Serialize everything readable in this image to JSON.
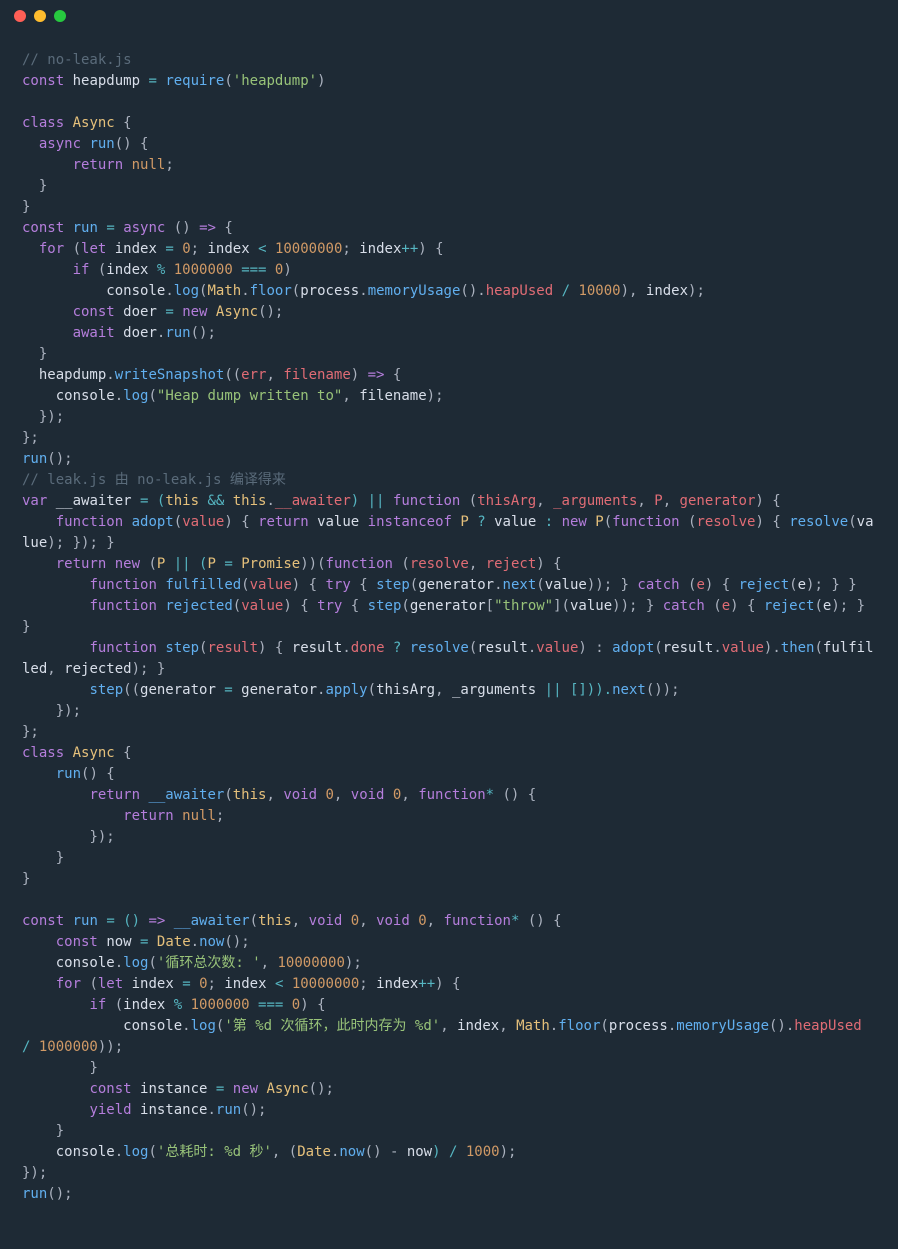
{
  "titlebar": {
    "buttons": [
      "close",
      "minimize",
      "zoom"
    ]
  },
  "code": {
    "comment1": "// no-leak.js",
    "l2_const": "const",
    "l2_var": "heapdump",
    "l2_eq": " = ",
    "l2_req": "require",
    "l2_paren_o": "(",
    "l2_str": "'heapdump'",
    "l2_paren_c": ")",
    "l4_class": "class",
    "l4_name": "Async",
    "l4_brace": " {",
    "l5_async": "  async",
    "l5_run": "run",
    "l5_rest": "() {",
    "l6_ret": "      return",
    "l6_null": "null",
    "l6_semi": ";",
    "l7": "  }",
    "l8": "}",
    "l9_const": "const",
    "l9_run": "run",
    "l9_eq": " = ",
    "l9_async": "async",
    "l9_arrow": " () ",
    "l9_fat": "=>",
    "l9_brace": " {",
    "l10_for": "  for",
    "l10_paren": " (",
    "l10_let": "let",
    "l10_idx": "index",
    "l10_eq": " = ",
    "l10_zero": "0",
    "l10_semi1": "; ",
    "l10_idx2": "index",
    "l10_lt": " < ",
    "l10_max": "10000000",
    "l10_semi2": "; ",
    "l10_idx3": "index",
    "l10_inc": "++",
    "l10_end": ") {",
    "l11_if": "      if",
    "l11_paren": " (",
    "l11_idx": "index",
    "l11_mod": " % ",
    "l11_mil": "1000000",
    "l11_eq3": " === ",
    "l11_zero": "0",
    "l11_close": ")",
    "l12_cons": "          console",
    "l12_dot": ".",
    "l12_log": "log",
    "l12_po": "(",
    "l12_math": "Math",
    "l12_d2": ".",
    "l12_floor": "floor",
    "l12_po2": "(",
    "l12_proc": "process",
    "l12_d3": ".",
    "l12_mu": "memoryUsage",
    "l12_call": "().",
    "l12_hu": "heapUsed",
    "l12_div": " / ",
    "l12_ten": "10000",
    "l12_pc": "), ",
    "l12_idx": "index",
    "l12_end": ");",
    "l13_const": "      const",
    "l13_doer": "doer",
    "l13_eq": " = ",
    "l13_new": "new",
    "l13_async": "Async",
    "l13_end": "();",
    "l14_await": "      await",
    "l14_doer": "doer",
    "l14_d": ".",
    "l14_run": "run",
    "l14_end": "();",
    "l15": "  }",
    "l16_hd": "  heapdump",
    "l16_d": ".",
    "l16_ws": "writeSnapshot",
    "l16_po": "((",
    "l16_err": "err",
    "l16_c": ", ",
    "l16_fn": "filename",
    "l16_pc": ") ",
    "l16_fat": "=>",
    "l16_br": " {",
    "l17_cons": "    console",
    "l17_d": ".",
    "l17_log": "log",
    "l17_po": "(",
    "l17_str": "\"Heap dump written to\"",
    "l17_c": ", ",
    "l17_fn": "filename",
    "l17_end": ");",
    "l18": "  });",
    "l19": "};",
    "l20_run": "run",
    "l20_end": "();",
    "comment2": "// leak.js 由 no-leak.js 编译得来",
    "l22_var": "var",
    "l22_aw": "__awaiter",
    "l22_eq": " = (",
    "l22_this": "this",
    "l22_and": " && ",
    "l22_this2": "this",
    "l22_d": ".",
    "l22_aw2": "__awaiter",
    "l22_or": ") || ",
    "l22_fn": "function",
    "l22_args": " (",
    "l22_ta": "thisArg",
    "l22_c1": ", ",
    "l22_ua": "_arguments",
    "l22_c2": ", ",
    "l22_p": "P",
    "l22_c3": ", ",
    "l22_gen": "generator",
    "l22_end": ") {",
    "l23_fn": "    function",
    "l23_adopt": "adopt",
    "l23_po": "(",
    "l23_val": "value",
    "l23_pc": ") { ",
    "l23_ret": "return",
    "l23_val2": " value ",
    "l23_inst": "instanceof",
    "l23_p": " P ",
    "l23_q": "? ",
    "l23_val3": "value",
    "l23_col": " : ",
    "l23_new": "new",
    "l23_p2": " P",
    "l23_po2": "(",
    "l23_fn2": "function",
    "l23_po3": " (",
    "l23_res": "resolve",
    "l23_pc3": ") { ",
    "l23_res2": "resolve",
    "l23_po4": "(",
    "l23_val4": "value",
    "l23_end": "); }); }",
    "l24_ret": "    return",
    "l24_new": "new",
    "l24_po": " (",
    "l24_p": "P",
    "l24_or": " || (",
    "l24_p2": "P",
    "l24_eq": " = ",
    "l24_prom": "Promise",
    "l24_pc": "))(",
    "l24_fn": "function",
    "l24_po2": " (",
    "l24_res": "resolve",
    "l24_c": ", ",
    "l24_rej": "reject",
    "l24_end": ") {",
    "l25_fn": "        function",
    "l25_ful": "fulfilled",
    "l25_po": "(",
    "l25_val": "value",
    "l25_pc": ") { ",
    "l25_try": "try",
    "l25_br": " { ",
    "l25_step": "step",
    "l25_po2": "(",
    "l25_gen": "generator",
    "l25_d": ".",
    "l25_next": "next",
    "l25_po3": "(",
    "l25_val2": "value",
    "l25_pc2": ")); } ",
    "l25_catch": "catch",
    "l25_po4": " (",
    "l25_e": "e",
    "l25_pc3": ") { ",
    "l25_rej": "reject",
    "l25_po5": "(",
    "l25_e2": "e",
    "l25_end": "); } }",
    "l26_fn": "        function",
    "l26_rej": "rejected",
    "l26_po": "(",
    "l26_val": "value",
    "l26_pc": ") { ",
    "l26_try": "try",
    "l26_br": " { ",
    "l26_step": "step",
    "l26_po2": "(",
    "l26_gen": "generator",
    "l26_br1": "[",
    "l26_throw": "\"throw\"",
    "l26_br2": "](",
    "l26_val2": "value",
    "l26_pc2": ")); } ",
    "l26_catch": "catch",
    "l26_po4": " (",
    "l26_e": "e",
    "l26_pc3": ") { ",
    "l26_rej2": "reject",
    "l26_po5": "(",
    "l26_e2": "e",
    "l26_end": "); } }",
    "l27_fn": "        function",
    "l27_step": "step",
    "l27_po": "(",
    "l27_res": "result",
    "l27_pc": ") { ",
    "l27_res2": "result",
    "l27_d": ".",
    "l27_done": "done",
    "l27_q": " ? ",
    "l27_resolve": "resolve",
    "l27_po2": "(",
    "l27_res3": "result",
    "l27_d2": ".",
    "l27_val": "value",
    "l27_pc2": ") : ",
    "l27_adopt": "adopt",
    "l27_po3": "(",
    "l27_res4": "result",
    "l27_d3": ".",
    "l27_val2": "value",
    "l27_pc3": ").",
    "l27_then": "then",
    "l27_po4": "(",
    "l27_ful": "fulfilled",
    "l27_c": ", ",
    "l27_rej": "rejected",
    "l27_end": "); }",
    "l28_step": "        step",
    "l28_po": "((",
    "l28_gen": "generator",
    "l28_eq": " = ",
    "l28_gen2": "generator",
    "l28_d": ".",
    "l28_apply": "apply",
    "l28_po2": "(",
    "l28_ta": "thisArg",
    "l28_c": ", ",
    "l28_ua": "_arguments",
    "l28_or": " || [])).",
    "l28_next": "next",
    "l28_end": "());",
    "l29": "    });",
    "l30": "};",
    "l31_class": "class",
    "l31_async": "Async",
    "l31_br": " {",
    "l32_run": "    run",
    "l32_rest": "() {",
    "l33_ret": "        return",
    "l33_aw": "__awaiter",
    "l33_po": "(",
    "l33_this": "this",
    "l33_c1": ", ",
    "l33_void1": "void",
    "l33_z1": " 0",
    "l33_c2": ", ",
    "l33_void2": "void",
    "l33_z2": " 0",
    "l33_c3": ", ",
    "l33_fn": "function",
    "l33_star": "*",
    "l33_end": " () {",
    "l34_ret": "            return",
    "l34_null": "null",
    "l34_end": ";",
    "l35": "        });",
    "l36": "    }",
    "l37": "}",
    "l39_const": "const",
    "l39_run": "run",
    "l39_eq": " = () ",
    "l39_fat": "=>",
    "l39_aw": " __awaiter",
    "l39_po": "(",
    "l39_this": "this",
    "l39_c1": ", ",
    "l39_void1": "void",
    "l39_z1": " 0",
    "l39_c2": ", ",
    "l39_void2": "void",
    "l39_z2": " 0",
    "l39_c3": ", ",
    "l39_fn": "function",
    "l39_star": "*",
    "l39_end": " () {",
    "l40_const": "    const",
    "l40_now": "now",
    "l40_eq": " = ",
    "l40_date": "Date",
    "l40_d": ".",
    "l40_nowfn": "now",
    "l40_end": "();",
    "l41_cons": "    console",
    "l41_d": ".",
    "l41_log": "log",
    "l41_po": "(",
    "l41_str": "'循环总次数: '",
    "l41_c": ", ",
    "l41_num": "10000000",
    "l41_end": ");",
    "l42_for": "    for",
    "l42_po": " (",
    "l42_let": "let",
    "l42_idx": "index",
    "l42_eq": " = ",
    "l42_z": "0",
    "l42_s1": "; ",
    "l42_idx2": "index",
    "l42_lt": " < ",
    "l42_max": "10000000",
    "l42_s2": "; ",
    "l42_idx3": "index",
    "l42_inc": "++",
    "l42_end": ") {",
    "l43_if": "        if",
    "l43_po": " (",
    "l43_idx": "index",
    "l43_mod": " % ",
    "l43_mil": "1000000",
    "l43_eq3": " === ",
    "l43_z": "0",
    "l43_end": ") {",
    "l44_cons": "            console",
    "l44_d": ".",
    "l44_log": "log",
    "l44_po": "(",
    "l44_str": "'第 %d 次循环，此时内存为 %d'",
    "l44_c": ", ",
    "l44_idx": "index",
    "l44_c2": ", ",
    "l44_math": "Math",
    "l44_d2": ".",
    "l44_floor": "floor",
    "l44_po2": "(",
    "l44_proc": "process",
    "l44_d3": ".",
    "l44_mu": "memoryUsage",
    "l44_call": "().",
    "l44_hu": "heapUsed",
    "l44_div": " / ",
    "l44_mil2": "1000000",
    "l44_end": "));",
    "l45": "        }",
    "l46_const": "        const",
    "l46_inst": "instance",
    "l46_eq": " = ",
    "l46_new": "new",
    "l46_async": "Async",
    "l46_end": "();",
    "l47_yield": "        yield",
    "l47_inst": "instance",
    "l47_d": ".",
    "l47_run": "run",
    "l47_end": "();",
    "l48": "    }",
    "l49_cons": "    console",
    "l49_d": ".",
    "l49_log": "log",
    "l49_po": "(",
    "l49_str": "'总耗时: %d 秒'",
    "l49_c": ", (",
    "l49_date": "Date",
    "l49_d2": ".",
    "l49_now": "now",
    "l49_call": "() - ",
    "l49_nowvar": "now",
    "l49_div": ") / ",
    "l49_th": "1000",
    "l49_end": ");",
    "l50": "});",
    "l51_run": "run",
    "l51_end": "();"
  }
}
